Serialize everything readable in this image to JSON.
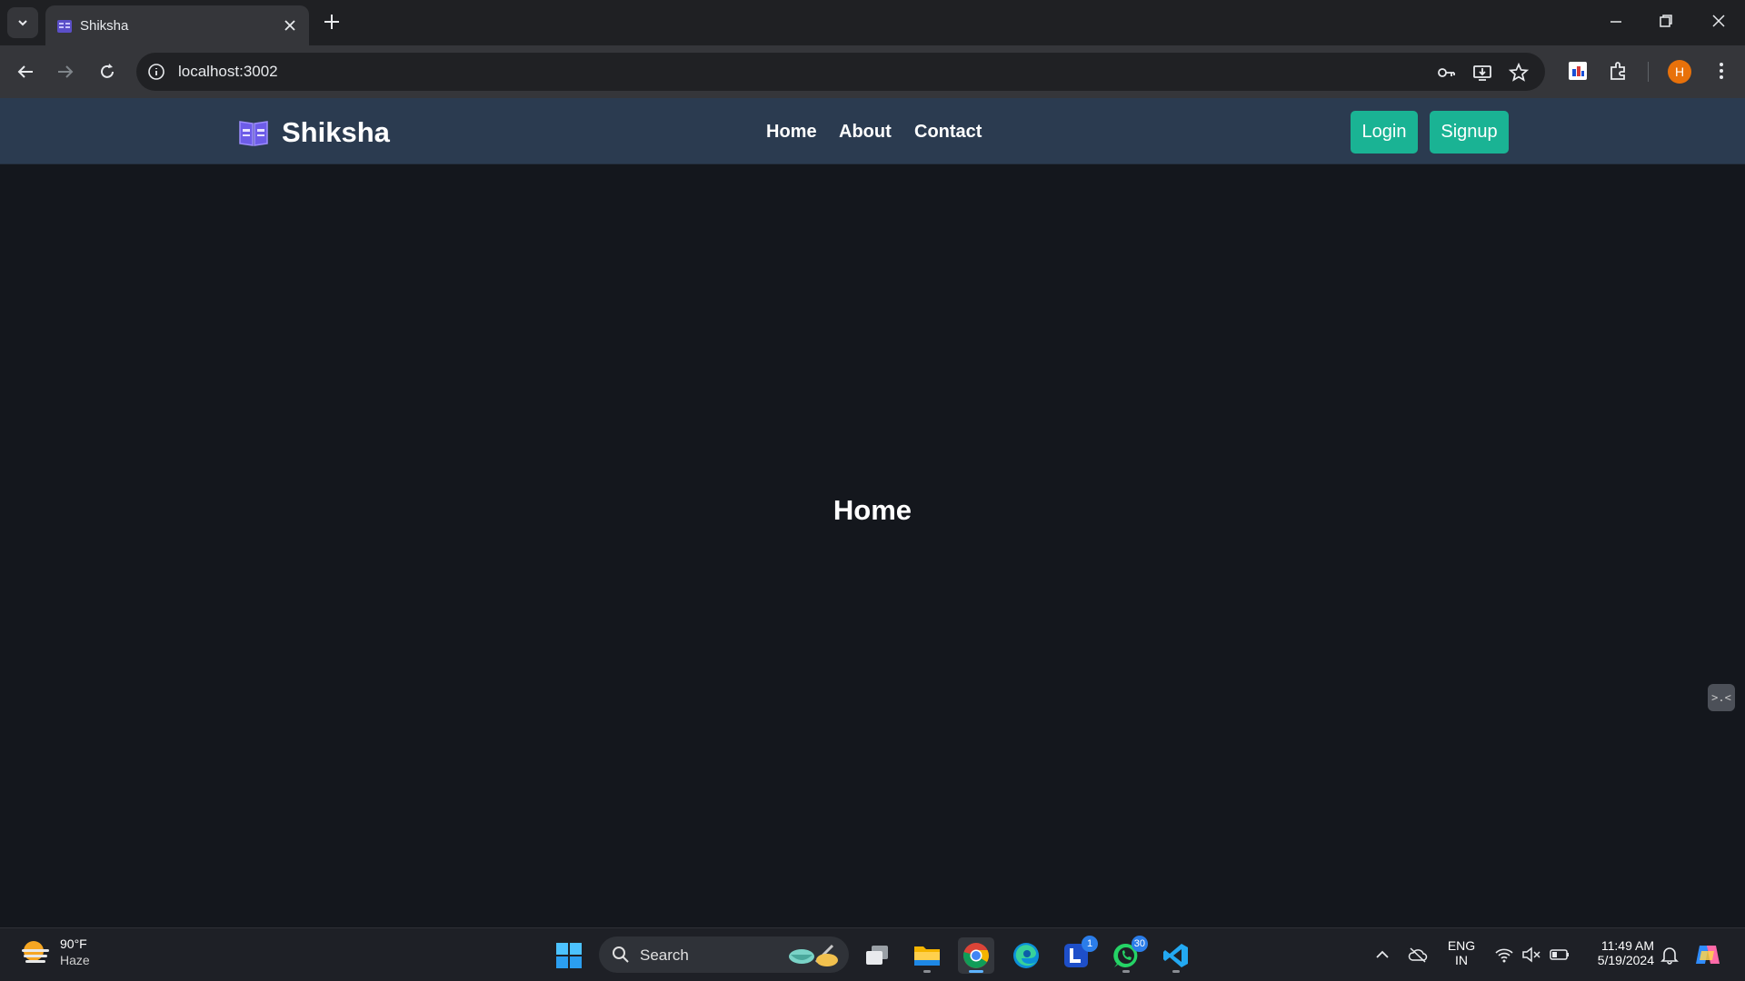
{
  "browser": {
    "tab_title": "Shiksha",
    "url": "localhost:3002",
    "profile_initial": "H"
  },
  "page": {
    "brand": "Shiksha",
    "nav": [
      "Home",
      "About",
      "Contact"
    ],
    "login_label": "Login",
    "signup_label": "Signup",
    "heading": "Home",
    "side_widget_label": ">.<",
    "accent_color": "#1ab394",
    "navbar_color": "#2b3b50"
  },
  "taskbar": {
    "weather_temp": "90°F",
    "weather_cond": "Haze",
    "search_label": "Search",
    "lens_badge": "1",
    "whatsapp_badge": "30",
    "lang_top": "ENG",
    "lang_bottom": "IN",
    "time": "11:49 AM",
    "date": "5/19/2024"
  }
}
